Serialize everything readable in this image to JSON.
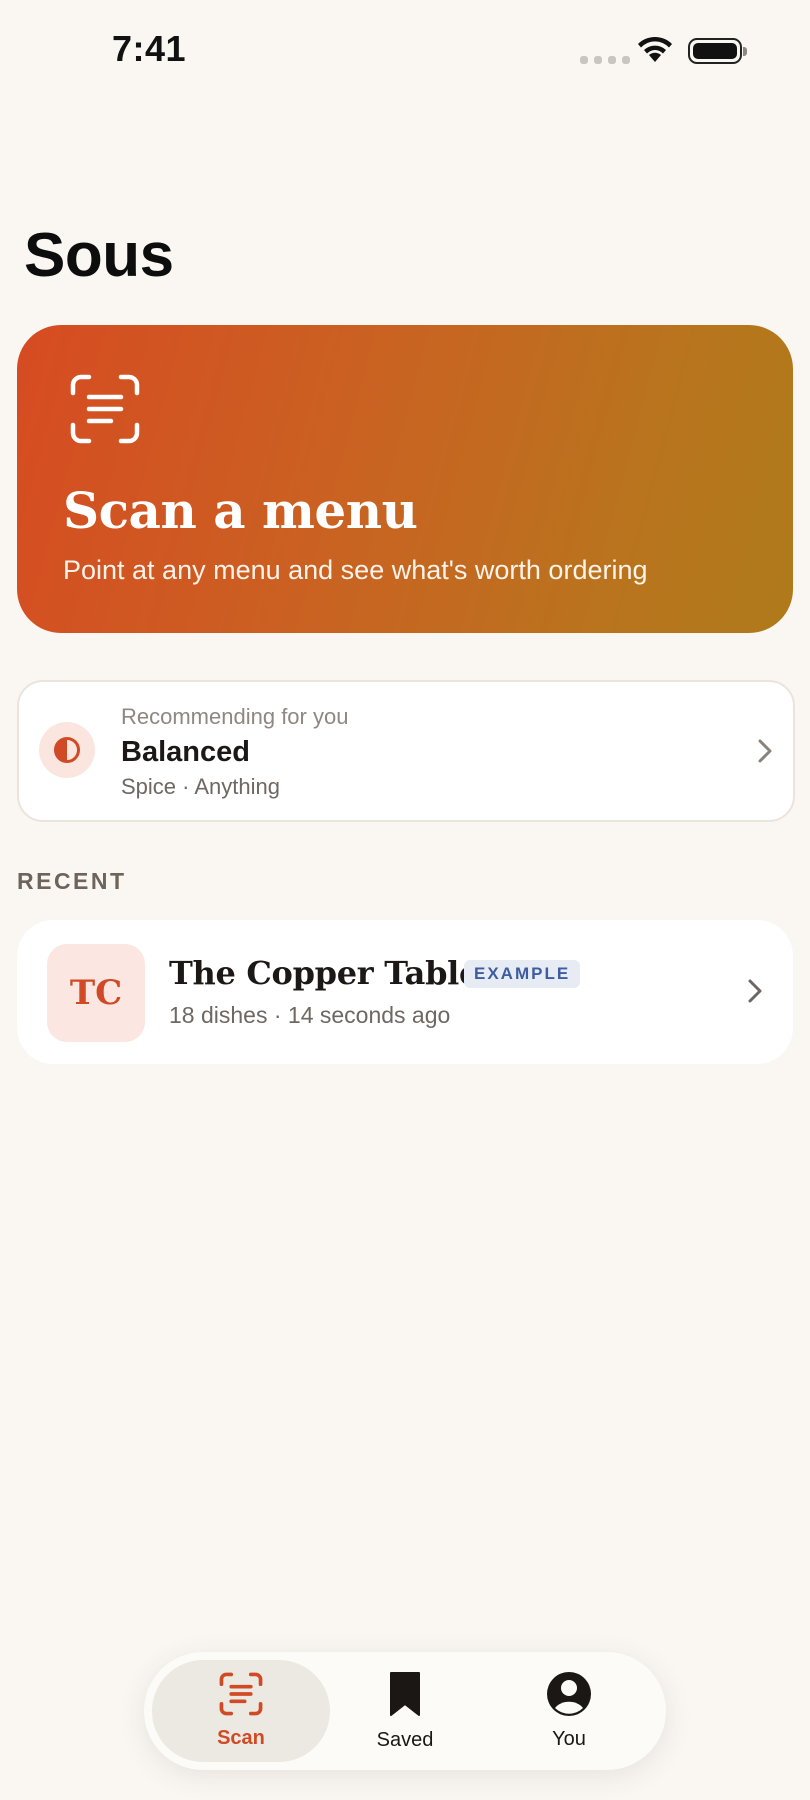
{
  "status_bar": {
    "time": "7:41"
  },
  "app": {
    "title": "Sous"
  },
  "hero": {
    "title": "Scan a menu",
    "subtitle": "Point at any menu and see what's worth ordering",
    "icon": "scan-text-icon"
  },
  "preference": {
    "caption": "Recommending for you",
    "title": "Balanced",
    "detail": "Spice · Anything",
    "icon": "half-circle-icon"
  },
  "recent": {
    "section_label": "RECENT",
    "items": [
      {
        "initials": "TC",
        "name": "The Copper Table",
        "badge": "EXAMPLE",
        "meta": "18 dishes · 14 seconds ago"
      }
    ]
  },
  "tabs": [
    {
      "label": "Scan",
      "icon": "scan-icon",
      "active": true
    },
    {
      "label": "Saved",
      "icon": "bookmark-icon",
      "active": false
    },
    {
      "label": "You",
      "icon": "person-icon",
      "active": false
    }
  ],
  "colors": {
    "accent": "#d14a26",
    "hero_start": "#d74b22",
    "hero_end": "#af7a1b",
    "badge_text": "#3e5ca0",
    "background": "#faf7f3"
  }
}
